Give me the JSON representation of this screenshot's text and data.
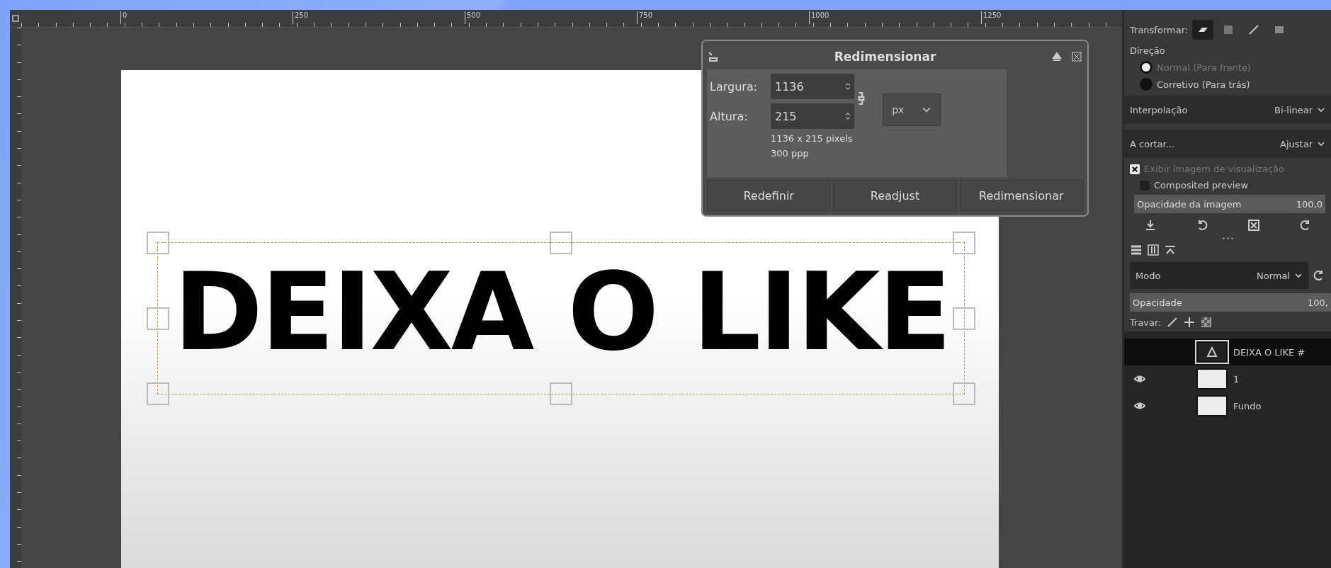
{
  "ruler": {
    "labels": [
      "0",
      "250",
      "500",
      "750",
      "1000",
      "1250"
    ]
  },
  "canvas": {
    "text": "DEIXA O LIKE"
  },
  "dialog": {
    "title": "Redimensionar",
    "fields": [
      {
        "label": "Largura:",
        "value": "1136"
      },
      {
        "label": "Altura:",
        "value": "215"
      }
    ],
    "unit": "px",
    "info": [
      "1136 x 215 pixels",
      "300 ppp"
    ],
    "buttons": [
      "Redefinir",
      "Readjust",
      "Redimensionar"
    ]
  },
  "tool_options": {
    "transform_label": "Transformar:",
    "transform_modes": [
      {
        "selected": true
      },
      {
        "selected": false
      },
      {
        "selected": false
      },
      {
        "selected": false
      }
    ],
    "direction_label": "Direção",
    "direction_options": [
      {
        "label": "Normal (Para frente)",
        "selected": true
      },
      {
        "label": "Corretivo (Para trás)",
        "selected": false
      }
    ],
    "interpolation": {
      "label": "Interpolação",
      "value": "Bi-linear"
    },
    "clipping": {
      "label": "A cortar...",
      "value": "Ajustar"
    },
    "show_preview": {
      "label": "Exibir imagem de visualização",
      "checked": true
    },
    "composited_preview": {
      "label": "Composited preview",
      "checked": false
    },
    "image_opacity": {
      "label": "Opacidade da imagem",
      "value": "100,0",
      "level": 1
    }
  },
  "layers": {
    "mode_label": "Modo",
    "mode": "Normal",
    "opacity": {
      "label": "Opacidade",
      "value": "100,",
      "level": 1
    },
    "lock_label": "Travar:",
    "items": [
      {
        "name": "DEIXA O LIKE #",
        "kind": "text",
        "visible": false,
        "selected": true
      },
      {
        "name": "1",
        "kind": "thumb",
        "visible": true,
        "selected": false
      },
      {
        "name": "Fundo",
        "kind": "plain",
        "visible": true,
        "selected": false
      }
    ]
  }
}
